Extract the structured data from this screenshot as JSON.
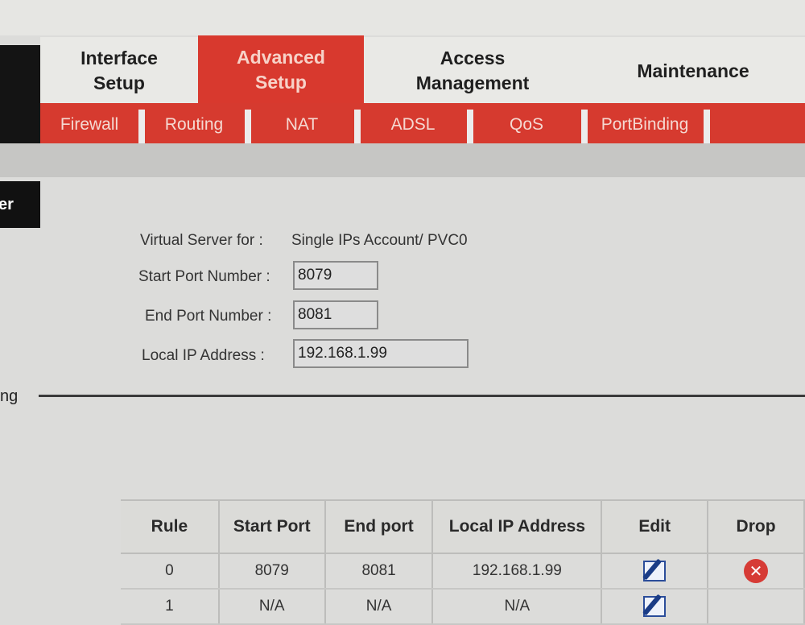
{
  "main_tabs": [
    {
      "label": "Interface\nSetup",
      "active": false
    },
    {
      "label": "Advanced\nSetup",
      "active": true
    },
    {
      "label": "Access\nManagement",
      "active": false
    },
    {
      "label": "Maintenance",
      "active": false
    }
  ],
  "sub_tabs": [
    "Firewall",
    "Routing",
    "NAT",
    "ADSL",
    "QoS",
    "PortBinding"
  ],
  "sidebar": {
    "selected_partial": "er",
    "other_partial": "ng"
  },
  "virtual_server": {
    "label": "Virtual Server for :",
    "value": "Single IPs Account/ PVC0"
  },
  "form": {
    "start_port_label": "Start Port Number :",
    "start_port_value": "8079",
    "end_port_label": "End Port Number :",
    "end_port_value": "8081",
    "local_ip_label": "Local IP Address :",
    "local_ip_value": "192.168.1.99"
  },
  "table": {
    "headers": [
      "Rule",
      "Start Port",
      "End port",
      "Local IP Address",
      "Edit",
      "Drop"
    ],
    "rows": [
      {
        "rule": "0",
        "start": "8079",
        "end": "8081",
        "ip": "192.168.1.99",
        "edit_icon": "edit-icon",
        "drop_icon": "delete-icon"
      },
      {
        "rule": "1",
        "start": "N/A",
        "end": "N/A",
        "ip": "N/A",
        "edit_icon": "edit-icon",
        "drop_icon": ""
      }
    ]
  },
  "colors": {
    "accent": "#d63a2f",
    "active_tab_text": "#f7d2c8"
  }
}
